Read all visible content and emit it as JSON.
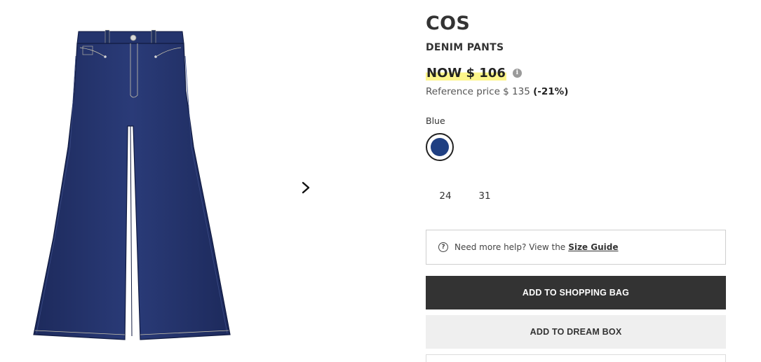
{
  "product": {
    "brand": "COS",
    "name": "DENIM PANTS",
    "price": {
      "sale": "NOW $ 106",
      "reference_label": "Reference price $ 135",
      "discount": "(-21%)",
      "info_icon": "i"
    },
    "color": {
      "label": "Blue",
      "swatch_hex": "#1f3f82"
    },
    "sizes": [
      "24",
      "31"
    ],
    "help": {
      "icon": "?",
      "text": "Need more help? View the",
      "link": "Size Guide"
    },
    "buttons": {
      "add_to_bag": "ADD TO SHOPPING BAG",
      "add_to_dream_box": "ADD TO DREAM BOX"
    }
  },
  "gallery": {
    "image": "flared-denim-pants",
    "next_icon": "chevron-right-icon"
  },
  "colors": {
    "denim": "#24346d",
    "stitching": "#c9c4ad",
    "price_highlight": "#fdf58a",
    "primary_button": "#333333",
    "secondary_button": "#efefef"
  }
}
